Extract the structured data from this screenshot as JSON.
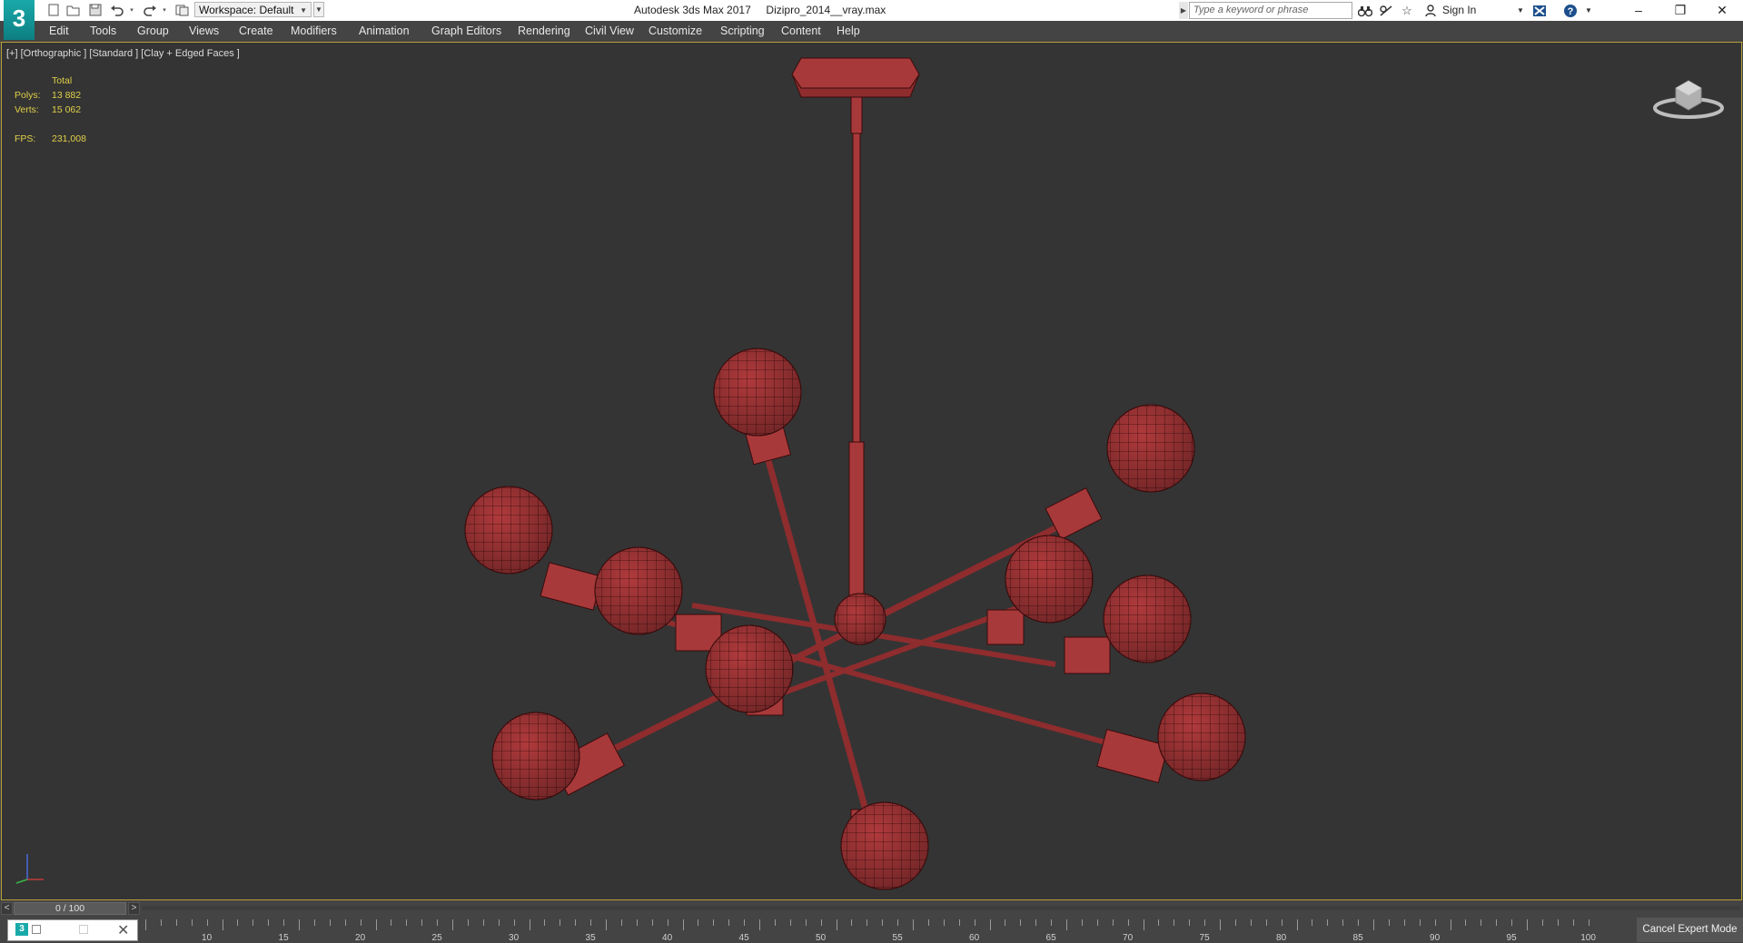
{
  "app": {
    "logo": "3",
    "window_title": "Autodesk 3ds Max 2017     Dizipro_2014__vray.max"
  },
  "toolbar": {
    "quick_access_icons": [
      "new-file-icon",
      "open-file-icon",
      "save-icon",
      "undo-icon",
      "redo-icon",
      "project-folder-icon"
    ],
    "workspace_label": "Workspace: Default",
    "search_placeholder": "Type a keyword or phrase",
    "sign_in_label": "Sign In"
  },
  "menu": {
    "items": [
      "Edit",
      "Tools",
      "Group",
      "Views",
      "Create",
      "Modifiers",
      "Animation",
      "Graph Editors",
      "Rendering",
      "Civil View",
      "Customize",
      "Scripting",
      "Content",
      "Help"
    ]
  },
  "viewport": {
    "label": "[+] [Orthographic ] [Standard ] [Clay + Edged Faces ]",
    "stats": {
      "total_label": "Total",
      "polys_label": "Polys:",
      "polys_value": "13 882",
      "verts_label": "Verts:",
      "verts_value": "15 062",
      "fps_label": "FPS:",
      "fps_value": "231,008"
    },
    "object_color": "#b5383a"
  },
  "timeslider": {
    "position_label": "0 / 100",
    "left_arrow": "<",
    "right_arrow": ">"
  },
  "ruler": {
    "labels": [
      "10",
      "15",
      "20",
      "25",
      "30",
      "35",
      "40",
      "45",
      "50",
      "55",
      "60",
      "65",
      "70",
      "75",
      "80",
      "85",
      "90",
      "95",
      "100"
    ]
  },
  "status": {
    "cancel_expert_label": "Cancel Expert Mode"
  },
  "window_controls": {
    "minimize": "–",
    "restore": "❐",
    "close": "✕"
  }
}
